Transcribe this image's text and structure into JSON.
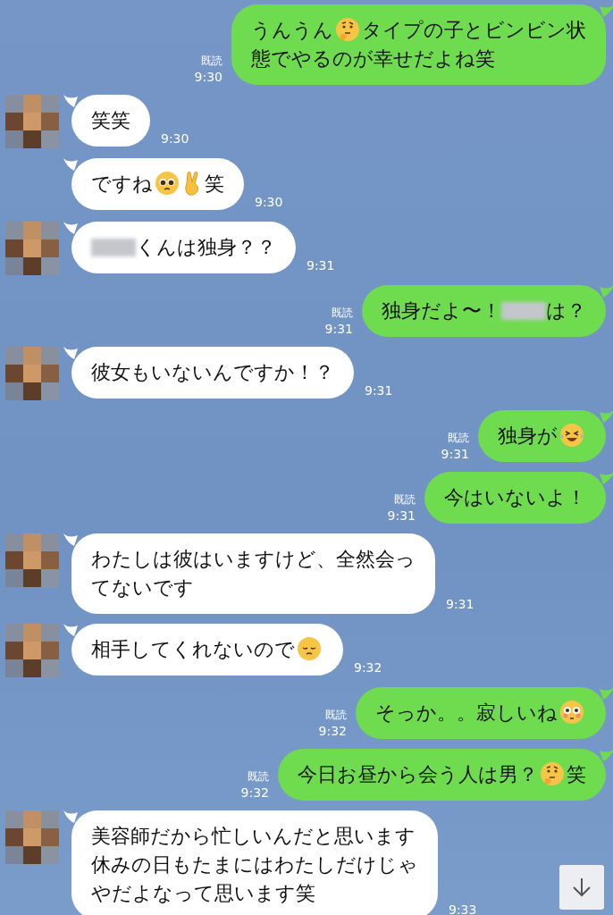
{
  "messages": [
    {
      "kind": "sent",
      "read_label": "既読",
      "time": "9:30",
      "lines": [
        [
          {
            "kind": "text",
            "text": "うんうん"
          },
          {
            "kind": "thinking"
          },
          {
            "kind": "text",
            "text": "タイプの子とビンビン状"
          }
        ],
        [
          {
            "kind": "text",
            "text": "態でやるのが幸せだよね笑"
          }
        ]
      ]
    },
    {
      "kind": "received",
      "avatar": true,
      "time": "9:30",
      "lines": [
        [
          {
            "kind": "text",
            "text": "笑笑"
          }
        ]
      ]
    },
    {
      "kind": "received",
      "avatar": false,
      "time": "9:30",
      "lines": [
        [
          {
            "kind": "text",
            "text": "ですね"
          },
          {
            "kind": "pleading"
          },
          {
            "kind": "victory"
          },
          {
            "kind": "text",
            "text": "笑"
          }
        ]
      ]
    },
    {
      "kind": "received",
      "avatar": true,
      "time": "9:31",
      "lines": [
        [
          {
            "kind": "redacted"
          },
          {
            "kind": "text",
            "text": "くんは独身？？"
          }
        ]
      ]
    },
    {
      "kind": "sent",
      "read_label": "既読",
      "time": "9:31",
      "lines": [
        [
          {
            "kind": "text",
            "text": "独身だよ〜！"
          },
          {
            "kind": "redacted"
          },
          {
            "kind": "text",
            "text": "は？"
          }
        ]
      ]
    },
    {
      "kind": "received",
      "avatar": true,
      "time": "9:31",
      "lines": [
        [
          {
            "kind": "text",
            "text": "彼女もいないんですか！？"
          }
        ]
      ]
    },
    {
      "kind": "sent",
      "read_label": "既読",
      "time": "9:31",
      "lines": [
        [
          {
            "kind": "text",
            "text": "独身が"
          },
          {
            "kind": "laughing"
          }
        ]
      ]
    },
    {
      "kind": "sent",
      "read_label": "既読",
      "time": "9:31",
      "lines": [
        [
          {
            "kind": "text",
            "text": "今はいないよ！"
          }
        ]
      ]
    },
    {
      "kind": "received",
      "avatar": true,
      "time": "9:31",
      "lines": [
        [
          {
            "kind": "text",
            "text": "わたしは彼はいますけど、全然会っ"
          }
        ],
        [
          {
            "kind": "text",
            "text": "てないです"
          }
        ]
      ]
    },
    {
      "kind": "received",
      "avatar": true,
      "time": "9:32",
      "lines": [
        [
          {
            "kind": "text",
            "text": "相手してくれないので"
          },
          {
            "kind": "pensive"
          }
        ]
      ]
    },
    {
      "kind": "sent",
      "read_label": "既読",
      "time": "9:32",
      "lines": [
        [
          {
            "kind": "text",
            "text": "そっか。。寂しいね"
          },
          {
            "kind": "flushed"
          }
        ]
      ]
    },
    {
      "kind": "sent",
      "read_label": "既読",
      "time": "9:32",
      "lines": [
        [
          {
            "kind": "text",
            "text": "今日お昼から会う人は男？"
          },
          {
            "kind": "thinking"
          },
          {
            "kind": "text",
            "text": "笑"
          }
        ]
      ]
    },
    {
      "kind": "received",
      "avatar": true,
      "time": "9:33",
      "lines": [
        [
          {
            "kind": "text",
            "text": "美容師だから忙しいんだと思います"
          }
        ],
        [
          {
            "kind": "text",
            "text": "休みの日もたまにはわたしだけじゃ"
          }
        ],
        [
          {
            "kind": "text",
            "text": "やだよなって思います笑"
          }
        ]
      ]
    }
  ]
}
